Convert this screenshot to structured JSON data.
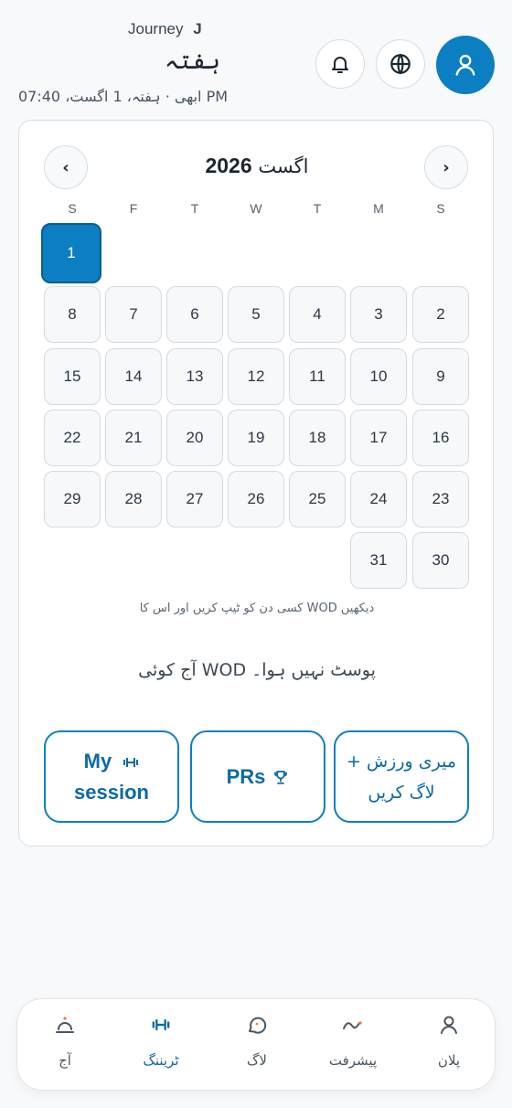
{
  "header": {
    "brand": "Journey",
    "brand_mark": "J",
    "title": "ہفتہ",
    "status": "ابھی · ہفتہ، 1 اگست، 07:40 PM"
  },
  "calendar": {
    "month": "اگست",
    "year": "2026",
    "weekdays": [
      "S",
      "F",
      "T",
      "W",
      "T",
      "M",
      "S"
    ],
    "days": [
      "1",
      "8",
      "7",
      "6",
      "5",
      "4",
      "3",
      "2",
      "15",
      "14",
      "13",
      "12",
      "11",
      "10",
      "9",
      "22",
      "21",
      "20",
      "19",
      "18",
      "17",
      "16",
      "29",
      "28",
      "27",
      "26",
      "25",
      "24",
      "23",
      "31",
      "30"
    ],
    "selected_day": "1",
    "hint": "کسی دن کو ٹیپ کریں اور اس کا WOD دیکھیں",
    "empty_state": "آج کوئی WOD پوسٹ نہیں ہوا۔"
  },
  "actions": {
    "session_line1": "My",
    "session_line2": "session",
    "prs": "PRs",
    "log_line1": "+ میری ورزش",
    "log_line2": "لاگ کریں"
  },
  "bottom_nav": {
    "items": [
      {
        "label": "آج",
        "icon": "today-icon"
      },
      {
        "label": "ٹریننگ",
        "icon": "dumbbell-icon"
      },
      {
        "label": "لاگ",
        "icon": "chat-icon"
      },
      {
        "label": "پیشرفت",
        "icon": "progress-icon"
      },
      {
        "label": "پلان",
        "icon": "user-icon"
      }
    ],
    "active": "ٹریننگ"
  },
  "colors": {
    "accent": "#0b7fc2",
    "background": "#f7f9fb"
  }
}
